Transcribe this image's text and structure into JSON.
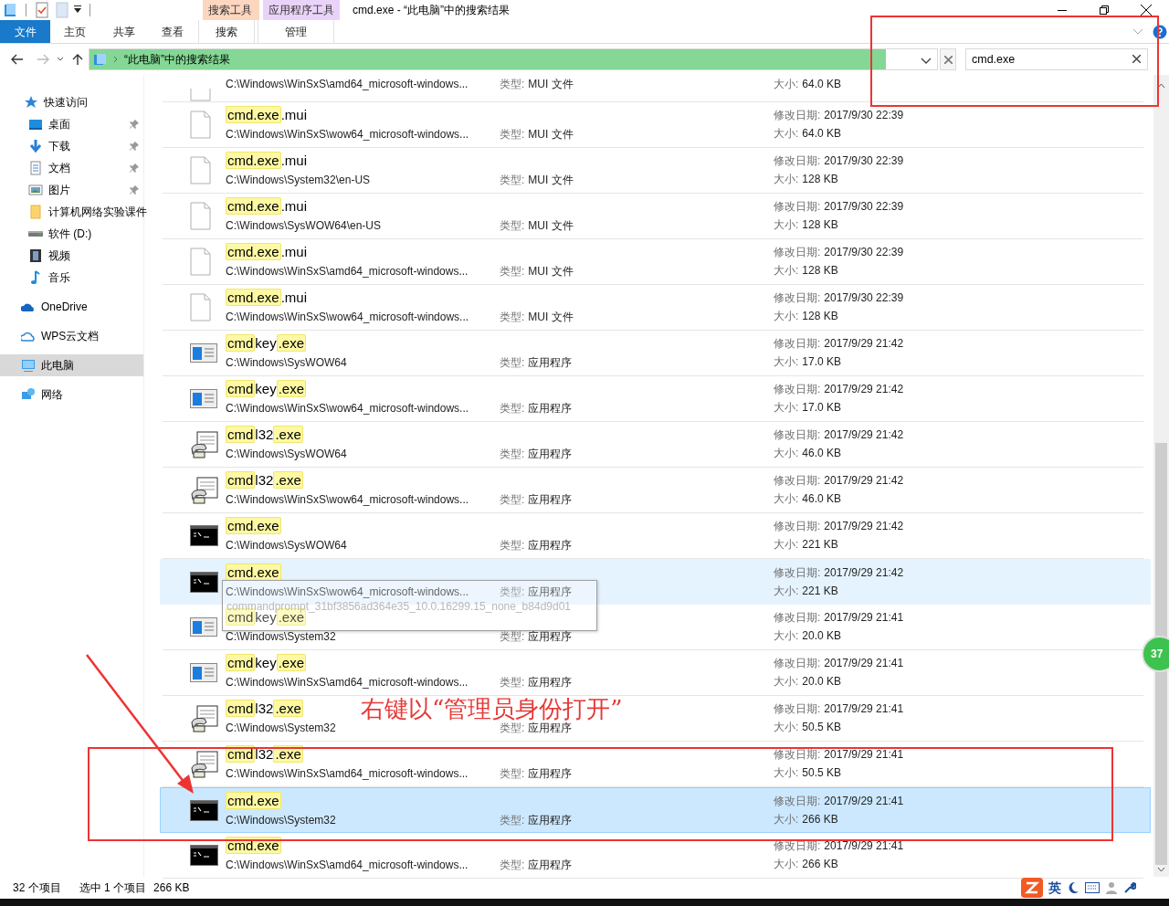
{
  "window": {
    "title": "cmd.exe - “此电脑”中的搜索结果"
  },
  "context_groups": [
    {
      "label": "搜索工具",
      "color": "#fcd6bf"
    },
    {
      "label": "应用程序工具",
      "color": "#ead3f8"
    }
  ],
  "ribbon_tabs": [
    {
      "label": "文件",
      "kind": "file"
    },
    {
      "label": "主页",
      "kind": "plain"
    },
    {
      "label": "共享",
      "kind": "plain"
    },
    {
      "label": "查看",
      "kind": "plain"
    },
    {
      "label": "搜索",
      "kind": "context"
    },
    {
      "label": "管理",
      "kind": "context"
    }
  ],
  "address": {
    "path": "“此电脑”中的搜索结果",
    "level": 0.94
  },
  "search": {
    "value": "cmd.exe"
  },
  "nav": [
    {
      "label": "快速访问",
      "kind": "star",
      "selected": false,
      "children": [
        {
          "label": "桌面",
          "kind": "desktop",
          "pinned": true,
          "selected": false
        },
        {
          "label": "下载",
          "kind": "download",
          "pinned": true,
          "selected": false
        },
        {
          "label": "文档",
          "kind": "document",
          "pinned": true,
          "selected": false
        },
        {
          "label": "图片",
          "kind": "picture",
          "pinned": true,
          "selected": false
        },
        {
          "label": "计算机网络实验课件",
          "kind": "folder",
          "pinned": false,
          "selected": false
        },
        {
          "label": "软件 (D:)",
          "kind": "drive",
          "pinned": false,
          "selected": false
        },
        {
          "label": "视频",
          "kind": "video",
          "pinned": false,
          "selected": false
        },
        {
          "label": "音乐",
          "kind": "music",
          "pinned": false,
          "selected": false
        }
      ]
    },
    {
      "label": "OneDrive",
      "kind": "onedrive",
      "selected": false
    },
    {
      "label": "WPS云文档",
      "kind": "cloud",
      "selected": false
    },
    {
      "label": "此电脑",
      "kind": "pc",
      "selected": true
    },
    {
      "label": "网络",
      "kind": "network",
      "selected": false
    }
  ],
  "rows": [
    {
      "kind": "mui",
      "path": "C:\\Windows\\WinSxS\\amd64_microsoft-windows...",
      "type_label": "类型:",
      "type": "MUI 文件",
      "size_label": "大小:",
      "size": "64.0 KB",
      "selected": false,
      "hovered": false
    },
    {
      "kind": "mui",
      "name": [
        {
          "text": "cmd.exe",
          "match": true
        },
        {
          "text": ".mui",
          "match": false
        }
      ],
      "path": "C:\\Windows\\WinSxS\\wow64_microsoft-windows...",
      "type_label": "类型:",
      "type": "MUI 文件",
      "date_label": "修改日期:",
      "date": "2017/9/30 22:39",
      "size_label": "大小:",
      "size": "64.0 KB",
      "selected": false,
      "hovered": false
    },
    {
      "kind": "mui",
      "name": [
        {
          "text": "cmd.exe",
          "match": true
        },
        {
          "text": ".mui",
          "match": false
        }
      ],
      "path": "C:\\Windows\\System32\\en-US",
      "type_label": "类型:",
      "type": "MUI 文件",
      "date_label": "修改日期:",
      "date": "2017/9/30 22:39",
      "size_label": "大小:",
      "size": "128 KB",
      "selected": false,
      "hovered": false
    },
    {
      "kind": "mui",
      "name": [
        {
          "text": "cmd.exe",
          "match": true
        },
        {
          "text": ".mui",
          "match": false
        }
      ],
      "path": "C:\\Windows\\SysWOW64\\en-US",
      "type_label": "类型:",
      "type": "MUI 文件",
      "date_label": "修改日期:",
      "date": "2017/9/30 22:39",
      "size_label": "大小:",
      "size": "128 KB",
      "selected": false,
      "hovered": false
    },
    {
      "kind": "mui",
      "name": [
        {
          "text": "cmd.exe",
          "match": true
        },
        {
          "text": ".mui",
          "match": false
        }
      ],
      "path": "C:\\Windows\\WinSxS\\amd64_microsoft-windows...",
      "type_label": "类型:",
      "type": "MUI 文件",
      "date_label": "修改日期:",
      "date": "2017/9/30 22:39",
      "size_label": "大小:",
      "size": "128 KB",
      "selected": false,
      "hovered": false
    },
    {
      "kind": "mui",
      "name": [
        {
          "text": "cmd.exe",
          "match": true
        },
        {
          "text": ".mui",
          "match": false
        }
      ],
      "path": "C:\\Windows\\WinSxS\\wow64_microsoft-windows...",
      "type_label": "类型:",
      "type": "MUI 文件",
      "date_label": "修改日期:",
      "date": "2017/9/30 22:39",
      "size_label": "大小:",
      "size": "128 KB",
      "selected": false,
      "hovered": false
    },
    {
      "kind": "cmdkey",
      "name": [
        {
          "text": "cmd",
          "match": true
        },
        {
          "text": "key",
          "match": false
        },
        {
          "text": ".exe",
          "match": true
        }
      ],
      "path": "C:\\Windows\\SysWOW64",
      "type_label": "类型:",
      "type": "应用程序",
      "date_label": "修改日期:",
      "date": "2017/9/29 21:42",
      "size_label": "大小:",
      "size": "17.0 KB",
      "selected": false,
      "hovered": false
    },
    {
      "kind": "cmdkey",
      "name": [
        {
          "text": "cmd",
          "match": true
        },
        {
          "text": "key",
          "match": false
        },
        {
          "text": ".exe",
          "match": true
        }
      ],
      "path": "C:\\Windows\\WinSxS\\wow64_microsoft-windows...",
      "type_label": "类型:",
      "type": "应用程序",
      "date_label": "修改日期:",
      "date": "2017/9/29 21:42",
      "size_label": "大小:",
      "size": "17.0 KB",
      "selected": false,
      "hovered": false
    },
    {
      "kind": "cmdl32",
      "name": [
        {
          "text": "cmd",
          "match": true
        },
        {
          "text": "l32",
          "match": false
        },
        {
          "text": ".exe",
          "match": true
        }
      ],
      "path": "C:\\Windows\\SysWOW64",
      "type_label": "类型:",
      "type": "应用程序",
      "date_label": "修改日期:",
      "date": "2017/9/29 21:42",
      "size_label": "大小:",
      "size": "46.0 KB",
      "selected": false,
      "hovered": false
    },
    {
      "kind": "cmdl32",
      "name": [
        {
          "text": "cmd",
          "match": true
        },
        {
          "text": "l32",
          "match": false
        },
        {
          "text": ".exe",
          "match": true
        }
      ],
      "path": "C:\\Windows\\WinSxS\\wow64_microsoft-windows...",
      "type_label": "类型:",
      "type": "应用程序",
      "date_label": "修改日期:",
      "date": "2017/9/29 21:42",
      "size_label": "大小:",
      "size": "46.0 KB",
      "selected": false,
      "hovered": false
    },
    {
      "kind": "cmd",
      "name": [
        {
          "text": "cmd.exe",
          "match": true
        }
      ],
      "path": "C:\\Windows\\SysWOW64",
      "type_label": "类型:",
      "type": "应用程序",
      "date_label": "修改日期:",
      "date": "2017/9/29 21:42",
      "size_label": "大小:",
      "size": "221 KB",
      "selected": false,
      "hovered": false
    },
    {
      "kind": "cmd",
      "name": [
        {
          "text": "cmd.exe",
          "match": true
        }
      ],
      "path": "C:\\Windows\\WinSxS\\wow64_microsoft-windows...",
      "type_label": "类型:",
      "type": "应用程序",
      "date_label": "修改日期:",
      "date": "2017/9/29 21:42",
      "size_label": "大小:",
      "size": "221 KB",
      "selected": false,
      "hovered": true,
      "tooltip": "commandprompt_31bf3856ad364e35_10.0.16299.15_none_b84d9d01"
    },
    {
      "kind": "cmdkey",
      "name": [
        {
          "text": "cmd",
          "match": true
        },
        {
          "text": "key",
          "match": false
        },
        {
          "text": ".exe",
          "match": true
        }
      ],
      "path": "C:\\Windows\\System32",
      "type_label": "类型:",
      "type": "应用程序",
      "date_label": "修改日期:",
      "date": "2017/9/29 21:41",
      "size_label": "大小:",
      "size": "20.0 KB",
      "selected": false,
      "hovered": false
    },
    {
      "kind": "cmdkey",
      "name": [
        {
          "text": "cmd",
          "match": true
        },
        {
          "text": "key",
          "match": false
        },
        {
          "text": ".exe",
          "match": true
        }
      ],
      "path": "C:\\Windows\\WinSxS\\amd64_microsoft-windows...",
      "type_label": "类型:",
      "type": "应用程序",
      "date_label": "修改日期:",
      "date": "2017/9/29 21:41",
      "size_label": "大小:",
      "size": "20.0 KB",
      "selected": false,
      "hovered": false
    },
    {
      "kind": "cmdl32",
      "name": [
        {
          "text": "cmd",
          "match": true
        },
        {
          "text": "l32",
          "match": false
        },
        {
          "text": ".exe",
          "match": true
        }
      ],
      "path": "C:\\Windows\\System32",
      "type_label": "类型:",
      "type": "应用程序",
      "date_label": "修改日期:",
      "date": "2017/9/29 21:41",
      "size_label": "大小:",
      "size": "50.5 KB",
      "selected": false,
      "hovered": false
    },
    {
      "kind": "cmdl32",
      "name": [
        {
          "text": "cmd",
          "match": true
        },
        {
          "text": "l32",
          "match": false
        },
        {
          "text": ".exe",
          "match": true
        }
      ],
      "path": "C:\\Windows\\WinSxS\\amd64_microsoft-windows...",
      "type_label": "类型:",
      "type": "应用程序",
      "date_label": "修改日期:",
      "date": "2017/9/29 21:41",
      "size_label": "大小:",
      "size": "50.5 KB",
      "selected": false,
      "hovered": false
    },
    {
      "kind": "cmd",
      "name": [
        {
          "text": "cmd.exe",
          "match": true
        }
      ],
      "path": "C:\\Windows\\System32",
      "type_label": "类型:",
      "type": "应用程序",
      "date_label": "修改日期:",
      "date": "2017/9/29 21:41",
      "size_label": "大小:",
      "size": "266 KB",
      "selected": true,
      "hovered": false
    },
    {
      "kind": "cmd",
      "name": [
        {
          "text": "cmd.exe",
          "match": true
        }
      ],
      "path": "C:\\Windows\\WinSxS\\amd64_microsoft-windows...",
      "type_label": "类型:",
      "type": "应用程序",
      "date_label": "修改日期:",
      "date": "2017/9/29 21:41",
      "size_label": "大小:",
      "size": "266 KB",
      "selected": false,
      "hovered": false
    }
  ],
  "status_bar": {
    "count": "32 个项目",
    "selection": "选中 1 个项目",
    "size": "266 KB"
  },
  "tray": {
    "ime": "英"
  },
  "badge": {
    "text": "37"
  },
  "annotation": {
    "text": "右键以“管理员身份打开”"
  }
}
